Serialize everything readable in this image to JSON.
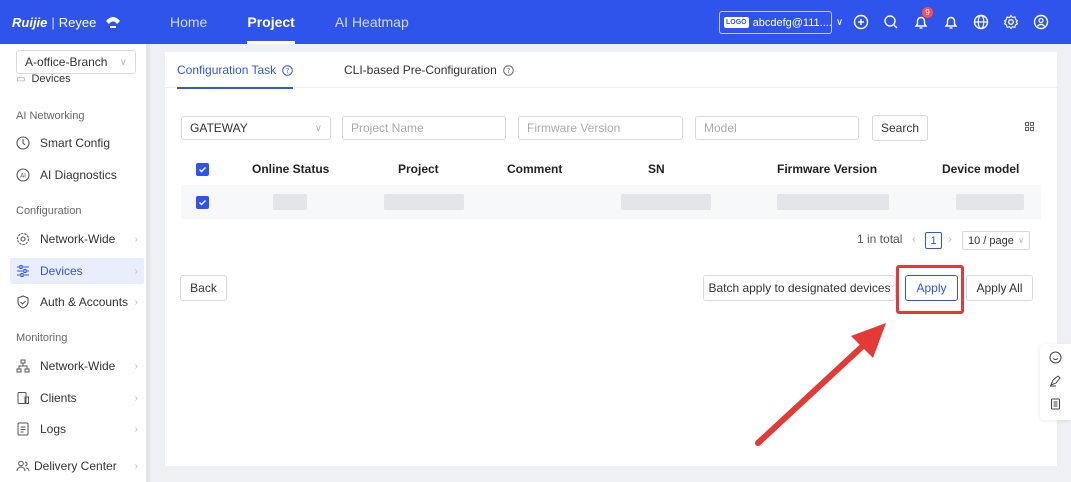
{
  "brand": {
    "name_part1": "Ruijie",
    "name_part2": "Reyee"
  },
  "topnav": {
    "items": [
      "Home",
      "Project",
      "AI Heatmap"
    ],
    "active": "Project"
  },
  "account": {
    "logo": "LOGO",
    "name": "abcdefg@111...."
  },
  "notifications": {
    "count": "9"
  },
  "top_icons": [
    "add-icon",
    "search-icon",
    "notification-icon",
    "bell-icon",
    "globe-icon",
    "settings-icon",
    "user-icon"
  ],
  "sidebar": {
    "project": "A-office-Branch",
    "clipped_item": "Devices",
    "groups": {
      "ai_networking": "AI Networking",
      "configuration": "Configuration",
      "monitoring": "Monitoring"
    },
    "items": {
      "smart_config": "Smart Config",
      "ai_diagnostics": "AI Diagnostics",
      "network_wide": "Network-Wide",
      "devices": "Devices",
      "auth_accounts": "Auth & Accounts",
      "mon_network_wide": "Network-Wide",
      "clients": "Clients",
      "logs": "Logs",
      "delivery_center": "Delivery Center"
    }
  },
  "tabs": {
    "config_task": "Configuration Task",
    "cli_preconfig": "CLI-based Pre-Configuration"
  },
  "filters": {
    "device_type": "GATEWAY",
    "project_name_ph": "Project Name",
    "firmware_ph": "Firmware Version",
    "model_ph": "Model",
    "search_label": "Search"
  },
  "table": {
    "columns": [
      "Online Status",
      "Project",
      "Comment",
      "SN",
      "Firmware Version",
      "Device model"
    ]
  },
  "pagination": {
    "total": "1 in total",
    "page": "1",
    "page_size": "10 / page"
  },
  "actions": {
    "back": "Back",
    "batch_apply": "Batch apply to designated devices",
    "apply": "Apply",
    "apply_all": "Apply All"
  },
  "annotation_color": "#e53935",
  "accent_color": "#2f54eb"
}
